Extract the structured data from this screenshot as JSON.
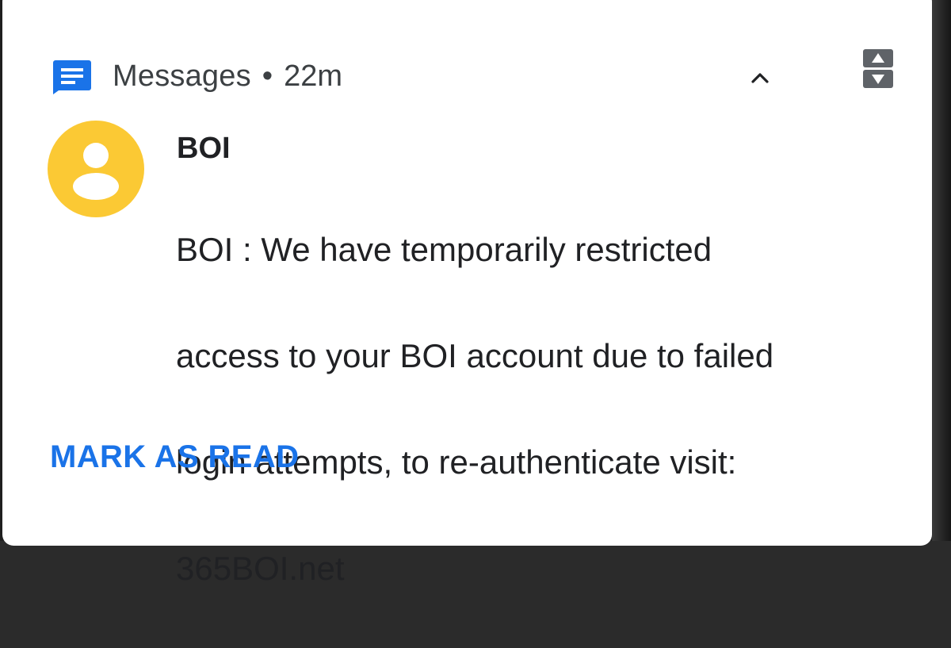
{
  "notification": {
    "app_name": "Messages",
    "separator": "•",
    "time_ago": "22m",
    "sender": "BOI",
    "message_lines": [
      "BOI : We have temporarily restricted",
      "access to your BOI account due to failed",
      "login attempts, to re-authenticate visit:",
      "365BOI.net"
    ],
    "action_label": "MARK AS READ"
  },
  "icons": {
    "app": "messages-app-icon",
    "collapse": "chevron-up-icon",
    "sort": "sort-arrows-icon",
    "avatar": "person-avatar-icon"
  },
  "colors": {
    "accent": "#1a73e8",
    "avatar_bg": "#fbc934",
    "sort_bg": "#5f6368",
    "text_primary": "#202124",
    "text_secondary": "#3c4043"
  }
}
